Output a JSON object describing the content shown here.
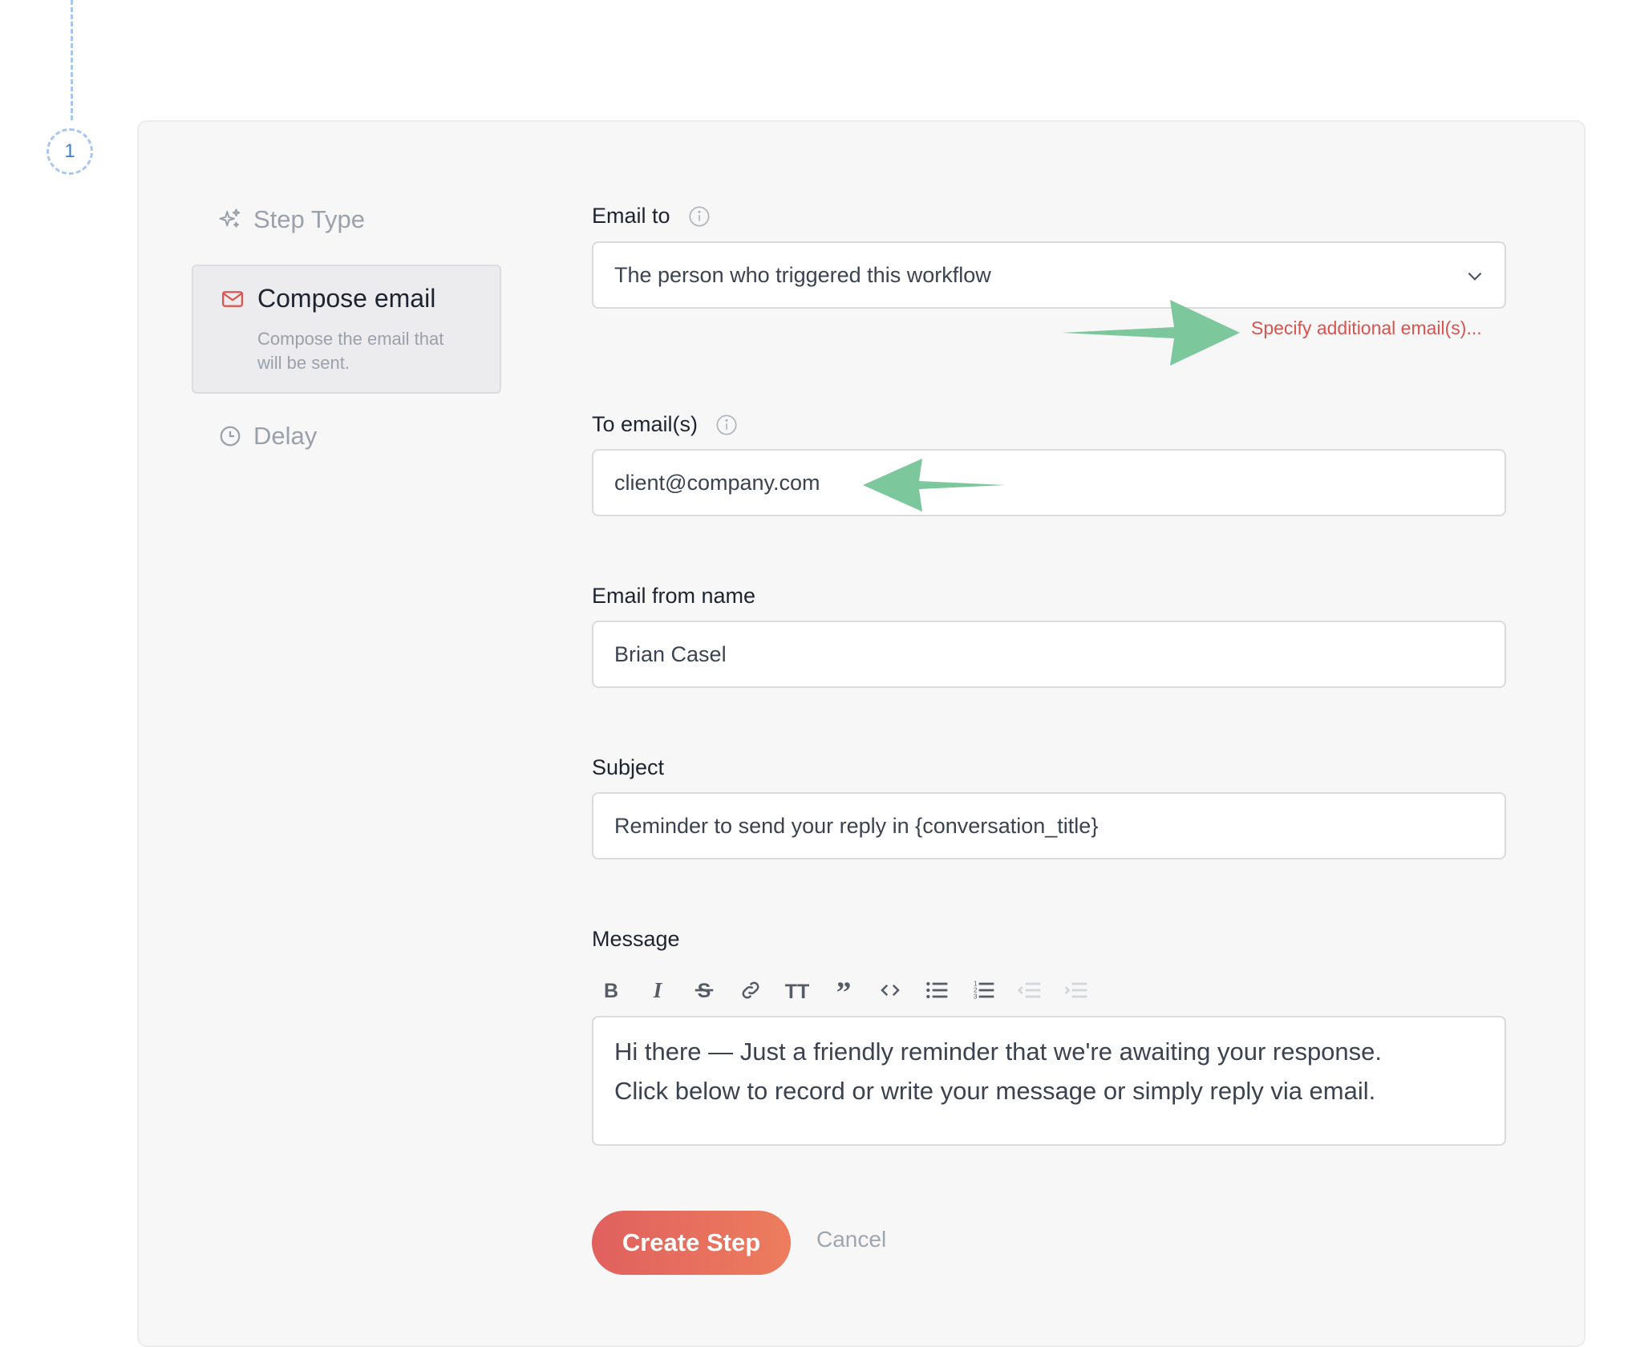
{
  "step": {
    "number": "1"
  },
  "sidebar": {
    "step_type": {
      "label": "Step Type",
      "icon": "sparkles-icon"
    },
    "compose": {
      "title": "Compose email",
      "description": "Compose the email that will be sent.",
      "icon": "envelope-icon"
    },
    "delay": {
      "label": "Delay",
      "icon": "clock-icon"
    }
  },
  "form": {
    "email_to": {
      "label": "Email to",
      "value": "The person who triggered this workflow"
    },
    "specify_link": "Specify additional email(s)...",
    "to_emails": {
      "label": "To email(s)",
      "value": "client@company.com"
    },
    "from_name": {
      "label": "Email from name",
      "value": "Brian Casel"
    },
    "subject": {
      "label": "Subject",
      "value": "Reminder to send your reply in {conversation_title}"
    },
    "message": {
      "label": "Message",
      "line1": "Hi there — Just a friendly reminder that we're awaiting your response.",
      "line2": "Click below to record or write your message or simply reply via email."
    },
    "toolbar": [
      "bold-icon",
      "italic-icon",
      "strikethrough-icon",
      "link-icon",
      "heading-icon",
      "quote-icon",
      "code-icon",
      "bullet-list-icon",
      "numbered-list-icon",
      "outdent-icon",
      "indent-icon"
    ]
  },
  "actions": {
    "create": "Create Step",
    "cancel": "Cancel"
  },
  "colors": {
    "accent_red": "#d9534f",
    "button_gradient_start": "#e0605e",
    "button_gradient_end": "#ec7d5d",
    "arrow_green": "#7cc79c",
    "timeline_blue": "#a9c7ee"
  }
}
